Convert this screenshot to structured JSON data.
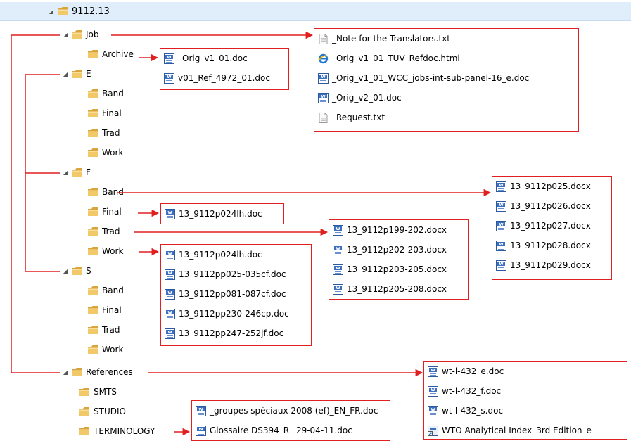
{
  "tree": {
    "root": "9112.13",
    "job": "Job",
    "archive": "Archive",
    "e": "E",
    "e_band": "Band",
    "e_final": "Final",
    "e_trad": "Trad",
    "e_work": "Work",
    "f": "F",
    "f_band": "Band",
    "f_final": "Final",
    "f_trad": "Trad",
    "f_work": "Work",
    "s": "S",
    "s_band": "Band",
    "s_final": "Final",
    "s_trad": "Trad",
    "s_work": "Work",
    "references": "References",
    "smts": "SMTS",
    "studio": "STUDIO",
    "terminology": "TERMINOLOGY"
  },
  "boxes": {
    "job_files": [
      {
        "name": "_Note for the Translators.txt",
        "icon": "text-file-icon"
      },
      {
        "name": "_Orig_v1_01_TUV_Refdoc.html",
        "icon": "ie-html-icon"
      },
      {
        "name": "_Orig_v1_01_WCC_jobs-int-sub-panel-16_e.doc",
        "icon": "word-doc-icon"
      },
      {
        "name": "_Orig_v2_01.doc",
        "icon": "word-doc-icon"
      },
      {
        "name": "_Request.txt",
        "icon": "text-file-icon"
      }
    ],
    "archive_files": [
      {
        "name": "_Orig_v1_01.doc",
        "icon": "word-doc-icon"
      },
      {
        "name": "v01_Ref_4972_01.doc",
        "icon": "word-doc-icon"
      }
    ],
    "f_band_files": [
      {
        "name": "13_9112p025.docx",
        "icon": "word-doc-icon"
      },
      {
        "name": "13_9112p026.docx",
        "icon": "word-doc-icon"
      },
      {
        "name": "13_9112p027.docx",
        "icon": "word-doc-icon"
      },
      {
        "name": "13_9112p028.docx",
        "icon": "word-doc-icon"
      },
      {
        "name": "13_9112p029.docx",
        "icon": "word-doc-icon"
      }
    ],
    "f_final_files": [
      {
        "name": "13_9112p024lh.doc",
        "icon": "word-doc-icon"
      }
    ],
    "f_trad_files": [
      {
        "name": "13_9112p199-202.docx",
        "icon": "word-doc-icon"
      },
      {
        "name": "13_9112p202-203.docx",
        "icon": "word-doc-icon"
      },
      {
        "name": "13_9112p203-205.docx",
        "icon": "word-doc-icon"
      },
      {
        "name": "13_9112p205-208.docx",
        "icon": "word-doc-icon"
      }
    ],
    "f_work_files": [
      {
        "name": "13_9112p024lh.doc",
        "icon": "word-doc-icon"
      },
      {
        "name": "13_9112pp025-035cf.doc",
        "icon": "word-doc-icon"
      },
      {
        "name": "13_9112pp081-087cf.doc",
        "icon": "word-doc-icon"
      },
      {
        "name": "13_9112pp230-246cp.doc",
        "icon": "word-doc-icon"
      },
      {
        "name": "13_9112pp247-252jf.doc",
        "icon": "word-doc-icon"
      }
    ],
    "references_files": [
      {
        "name": "wt-l-432_e.doc",
        "icon": "word-doc-icon"
      },
      {
        "name": "wt-l-432_f.doc",
        "icon": "word-doc-icon"
      },
      {
        "name": "wt-l-432_s.doc",
        "icon": "word-doc-icon"
      },
      {
        "name": "WTO Analytical Index_3rd Edition_e",
        "icon": "shortcut-icon"
      }
    ],
    "terminology_files": [
      {
        "name": "_groupes spéciaux 2008 (ef)_EN_FR.doc",
        "icon": "word-doc-icon"
      },
      {
        "name": "Glossaire DS394_R _29-04-11.doc",
        "icon": "word-doc-icon"
      }
    ]
  },
  "colors": {
    "annotation": "#e02020",
    "folder": "#e8b84a",
    "selection": "#dfeefa"
  }
}
